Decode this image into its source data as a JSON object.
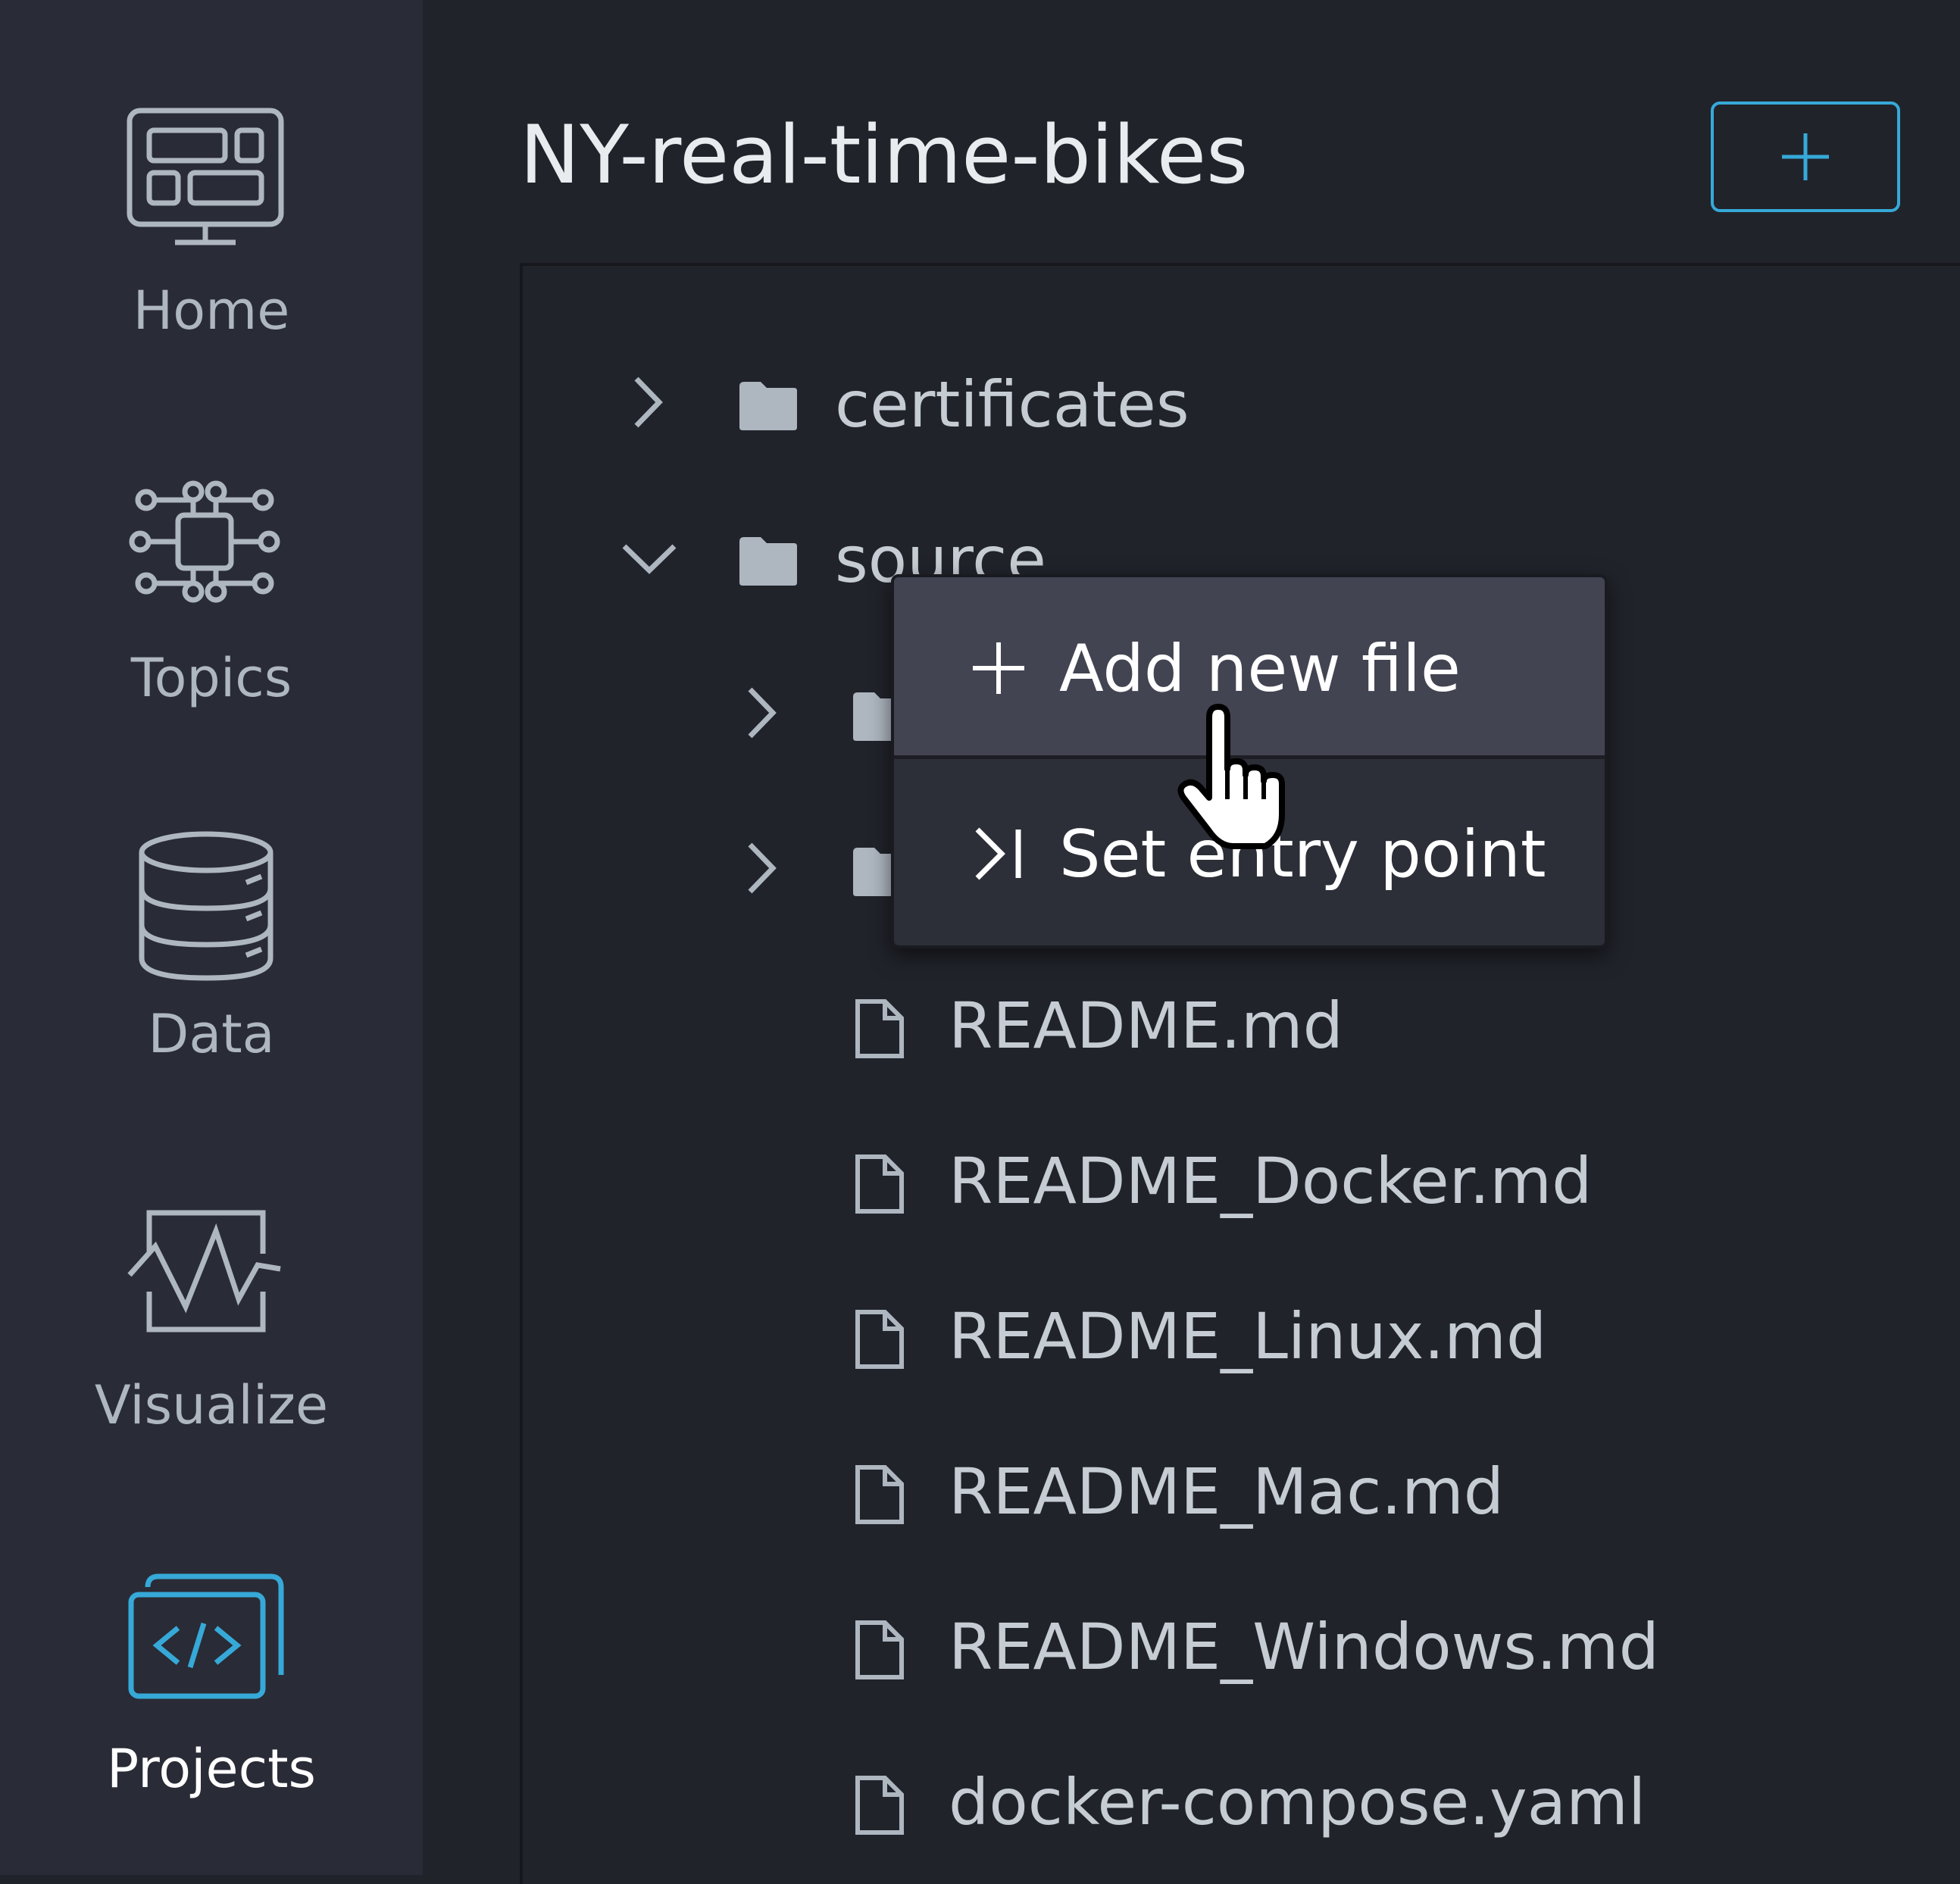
{
  "sidebar": {
    "items": [
      {
        "label": "Home",
        "icon": "home-dashboard-icon",
        "active": false
      },
      {
        "label": "Topics",
        "icon": "topics-network-icon",
        "active": false
      },
      {
        "label": "Data",
        "icon": "database-icon",
        "active": false
      },
      {
        "label": "Visualize",
        "icon": "visualize-chart-icon",
        "active": false
      },
      {
        "label": "Projects",
        "icon": "projects-code-icon",
        "active": true
      }
    ]
  },
  "main": {
    "title": "NY-real-time-bikes",
    "add_button_icon": "plus-icon"
  },
  "tree": {
    "items": [
      {
        "name": "certificates",
        "type": "folder",
        "expanded": false
      },
      {
        "name": "source",
        "type": "folder",
        "expanded": true
      },
      {
        "name": "README.md",
        "type": "file"
      },
      {
        "name": "README_Docker.md",
        "type": "file"
      },
      {
        "name": "README_Linux.md",
        "type": "file"
      },
      {
        "name": "README_Mac.md",
        "type": "file"
      },
      {
        "name": "README_Windows.md",
        "type": "file"
      },
      {
        "name": "docker-compose.yaml",
        "type": "file"
      }
    ]
  },
  "context_menu": {
    "items": [
      {
        "label": "Add new file",
        "icon": "plus-icon",
        "hovered": true
      },
      {
        "label": "Set entry point",
        "icon": "entry-point-icon",
        "hovered": false
      }
    ]
  },
  "colors": {
    "accent": "#36a9d8",
    "background": "#21232b",
    "sidebar": "#292b36",
    "menu_hover": "#434452"
  }
}
